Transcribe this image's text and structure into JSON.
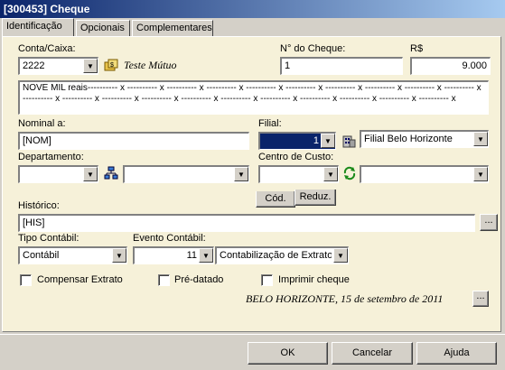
{
  "window": {
    "title": "[300453] Cheque"
  },
  "tabs": [
    {
      "label": "Identificação"
    },
    {
      "label": "Opcionais"
    },
    {
      "label": "Complementares"
    }
  ],
  "form": {
    "conta_caixa": {
      "label": "Conta/Caixa:",
      "value": "2222",
      "description": "Teste Mútuo"
    },
    "numero_cheque": {
      "label": "N° do Cheque:",
      "value": "1"
    },
    "valor": {
      "label": "R$",
      "value": "9.000"
    },
    "extenso": {
      "line1": "NOVE MIL reais---------- x ---------- x ---------- x ---------- x ---------- x ---------- x ---------- x ---------- x ---------- x ---------- x",
      "line2": "---------- x ---------- x ---------- x ---------- x ---------- x ---------- x ---------- x ---------- x ---------- x ---------- x ---------- x"
    },
    "nominal": {
      "label": "Nominal a:",
      "value": "[NOM]"
    },
    "filial": {
      "label": "Filial:",
      "value": "1",
      "description": "Filial Belo Horizonte"
    },
    "departamento": {
      "label": "Departamento:",
      "value": "",
      "description": ""
    },
    "centro_custo": {
      "label": "Centro de Custo:",
      "value": "",
      "description": ""
    },
    "centro_custo_subtabs": [
      "Cód.",
      "Reduz."
    ],
    "historico": {
      "label": "Histórico:",
      "value": "[HIS]"
    },
    "tipo_contabil": {
      "label": "Tipo Contábil:",
      "value": "Contábil"
    },
    "evento_contabil": {
      "label": "Evento Contábil:",
      "value": "11",
      "description": "Contabilização de Extrato d"
    },
    "checkboxes": {
      "compensar": "Compensar Extrato",
      "pre_datado": "Pré-datado",
      "imprimir": "Imprimir cheque"
    },
    "data_local": "BELO HORIZONTE, 15 de setembro  de 2011",
    "ellipsis": "..."
  },
  "buttons": {
    "ok": "OK",
    "cancelar": "Cancelar",
    "ajuda": "Ajuda"
  }
}
